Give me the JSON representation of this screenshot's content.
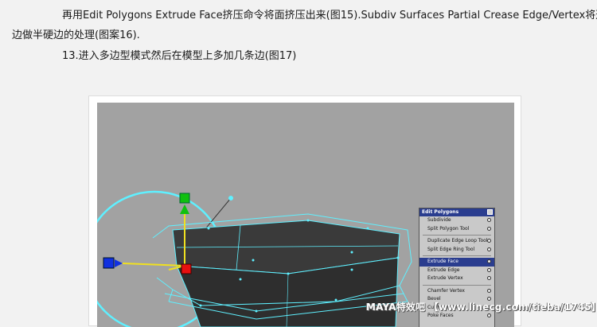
{
  "article": {
    "paragraph1_line1": "再用Edit Polygons Extrude Face挤压命令将面挤压出来(图15).Subdiv Surfaces Partial Crease Edge/Vertex将这些",
    "paragraph1_line2": "边做半硬边的处理(图案16).",
    "paragraph2": "13.进入多边型模式然后在模型上多加几条边(图17)"
  },
  "menu": {
    "title": "Edit Polygons",
    "items": [
      "Subdivide",
      "Split Polygon Tool",
      "Duplicate Edge Loop Tool",
      "Split Edge Ring Tool",
      "Extrude Face",
      "Extrude Edge",
      "Extrude Vertex",
      "Chamfer Vertex",
      "Bevel",
      "Cut Faces Tool",
      "Poke Faces"
    ],
    "active_item": "Extrude Face"
  },
  "watermark": "MAYA特效吧 【www.linecg.com/tieba/1745】",
  "colors": {
    "viewport_bg": "#a2a2a2",
    "wireframe": "#5ff0ff",
    "mesh_dark": "#2e2e2e",
    "menu_highlight": "#2a3d8f",
    "axis_x": "#e81010",
    "axis_y": "#10c010",
    "axis_z": "#1030e0",
    "manipulator_yellow": "#f0e020"
  }
}
